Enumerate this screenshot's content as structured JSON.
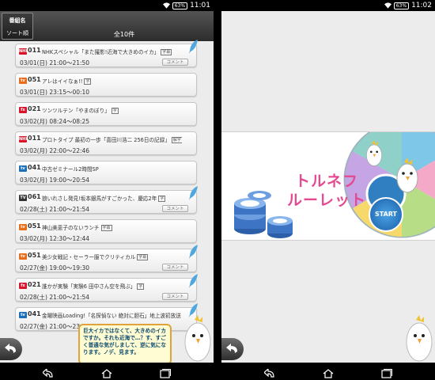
{
  "status_left": {
    "battery": "63%",
    "time": "11:01"
  },
  "status_right": {
    "battery": "63%",
    "time": "11:02"
  },
  "header": {
    "sort_label_1": "番組名",
    "sort_label_2": "ソート順",
    "count": "全10件"
  },
  "programs": [
    {
      "logo_color": "#d8162b",
      "logo": "NHK",
      "channel": "011",
      "title": "NHKスペシャル「また撮影!近海で大きめのイカ」",
      "tags": [
        "字幕"
      ],
      "date": "03/01(日) 21:00～21:50",
      "comment": "コメント",
      "pen": true
    },
    {
      "logo_color": "#e86d1b",
      "logo": "tv",
      "channel": "051",
      "title": "アレはイイなぁ!!",
      "tags": [
        "字"
      ],
      "date": "03/01(日) 23:15～00:10",
      "comment": "",
      "pen": false
    },
    {
      "logo_color": "#d8162b",
      "logo": "fx",
      "channel": "021",
      "title": "ツンツルテン「やまのぼり」",
      "tags": [
        "字"
      ],
      "date": "03/02(月) 08:24～08:25",
      "comment": "",
      "pen": false
    },
    {
      "logo_color": "#d8162b",
      "logo": "NHK",
      "channel": "011",
      "title": "プロトタイプ 最初の一歩「喜田川浩二 256日の記録」",
      "tags": [
        "解字"
      ],
      "date": "03/02(月) 22:00～22:46",
      "comment": "",
      "pen": false
    },
    {
      "logo_color": "#1d6fb8",
      "logo": "tv",
      "channel": "041",
      "title": "中古ゼミナール2時間SP",
      "tags": [],
      "date": "03/02(月) 19:00～20:54",
      "comment": "",
      "pen": false
    },
    {
      "logo_color": "#333333",
      "logo": "TV",
      "channel": "061",
      "title": "狼いれさし発見!坂本銀馬がすごかった、慶応2年",
      "tags": [
        "字"
      ],
      "date": "02/28(土) 21:00～21:54",
      "comment": "コメント",
      "pen": true
    },
    {
      "logo_color": "#e86d1b",
      "logo": "tv",
      "channel": "051",
      "title": "神山美恵子のないランチ",
      "tags": [
        "字幕"
      ],
      "date": "03/02(月) 12:30～12:44",
      "comment": "",
      "pen": false
    },
    {
      "logo_color": "#e86d1b",
      "logo": "tv",
      "channel": "051",
      "title": "美少女戦記・セーラー服でクリティカル",
      "tags": [
        "字幕"
      ],
      "date": "02/27(金) 19:00～19:30",
      "comment": "コメント",
      "pen": true
    },
    {
      "logo_color": "#d8162b",
      "logo": "fx",
      "channel": "021",
      "title": "誰かが実験「実験6 田中さん空を飛ぶ」",
      "tags": [
        "字"
      ],
      "date": "02/28(土) 21:00～21:54",
      "comment": "コメント",
      "pen": true
    },
    {
      "logo_color": "#1d6fb8",
      "logo": "tv",
      "channel": "041",
      "title": "金曜映画Loading!「名探偵ない 絶対に胆石」地上波初放送",
      "tags": [],
      "date": "02/27(金) 21:00～23…",
      "comment": "",
      "pen": true
    }
  ],
  "bubble_text": "巨大イカではなくて、大きめのイカですか。それも近海で…？す、すごく普通な気がしまして、逆に気になります。ノデ、見ます。",
  "roulette": {
    "line1": "トルネフ",
    "line2": "ルーレット",
    "start_label": "START"
  },
  "icons": {
    "back": "back-arrow-icon",
    "home": "home-icon",
    "recent": "recent-apps-icon",
    "wifi": "wifi-icon",
    "pen": "feather-pen-icon"
  }
}
